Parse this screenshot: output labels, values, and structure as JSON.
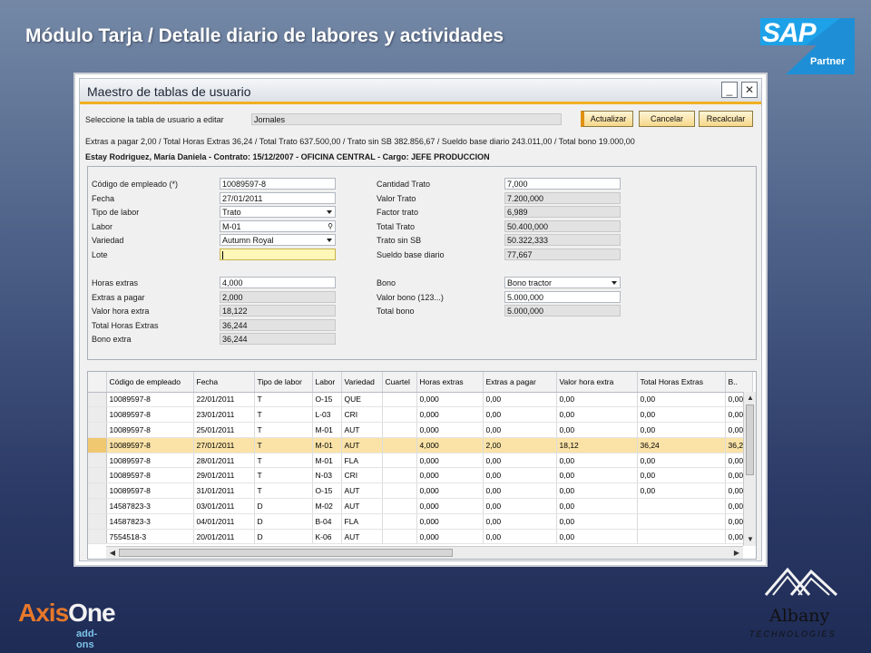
{
  "slide": {
    "title": "Módulo Tarja / Detalle diario de labores y actividades"
  },
  "brand": {
    "sap": "SAP",
    "partner": "Partner",
    "axis_main_1": "Axis",
    "axis_main_2": "One",
    "axis_sub": "add-ons",
    "albany": "Albany",
    "albany_sub": "TECHNOLOGIES"
  },
  "window": {
    "title": "Maestro de tablas de usuario",
    "minimize": "_",
    "close": "✕"
  },
  "top": {
    "select_label": "Seleccione la tabla de usuario a editar",
    "select_value": "Jornales",
    "btn_update": "Actualizar",
    "btn_cancel": "Cancelar",
    "btn_recalc": "Recalcular",
    "summary": "Extras a pagar 2,00 / Total Horas Extras 36,24 / Total Trato 637.500,00 / Trato sin SB 382.856,67 / Sueldo base diario 243.011,00 / Total bono 19.000,00",
    "employee": "Estay Rodriguez, María Daniela - Contrato: 15/12/2007 - OFICINA CENTRAL - Cargo: JEFE PRODUCCION"
  },
  "form": {
    "codigo_label": "Código de empleado (*)",
    "codigo": "10089597-8",
    "fecha_label": "Fecha",
    "fecha": "27/01/2011",
    "tipo_label": "Tipo de labor",
    "tipo": "Trato",
    "labor_label": "Labor",
    "labor": "M-01",
    "variedad_label": "Variedad",
    "variedad": "Autumn Royal",
    "lote_label": "Lote",
    "lote": "",
    "horas_label": "Horas extras",
    "horas": "4,000",
    "extras_label": "Extras a pagar",
    "extras": "2,000",
    "valor_hora_label": "Valor hora extra",
    "valor_hora": "18,122",
    "total_horas_label": "Total Horas Extras",
    "total_horas": "36,244",
    "bono_extra_label": "Bono extra",
    "bono_extra": "36,244",
    "cant_trato_label": "Cantidad Trato",
    "cant_trato": "7,000",
    "valor_trato_label": "Valor Trato",
    "valor_trato": "7.200,000",
    "factor_label": "Factor trato",
    "factor": "6,989",
    "total_trato_label": "Total Trato",
    "total_trato": "50.400,000",
    "trato_sb_label": "Trato sin SB",
    "trato_sb": "50.322,333",
    "sueldo_label": "Sueldo base diario",
    "sueldo": "77,667",
    "bono_label": "Bono",
    "bono": "Bono tractor",
    "valor_bono_label": "Valor bono (123...)",
    "valor_bono": "5.000,000",
    "total_bono_label": "Total bono",
    "total_bono": "5.000,000"
  },
  "grid": {
    "headers": [
      "Código de empleado",
      "Fecha",
      "Tipo de labor",
      "Labor",
      "Variedad",
      "Cuartel",
      "Horas extras",
      "Extras a pagar",
      "Valor hora extra",
      "Total Horas Extras",
      "B.."
    ],
    "rows": [
      [
        "10089597-8",
        "22/01/2011",
        "T",
        "O-15",
        "QUE",
        "",
        "0,000",
        "0,00",
        "0,00",
        "0,00",
        "0,00"
      ],
      [
        "10089597-8",
        "23/01/2011",
        "T",
        "L-03",
        "CRI",
        "",
        "0,000",
        "0,00",
        "0,00",
        "0,00",
        "0,00"
      ],
      [
        "10089597-8",
        "25/01/2011",
        "T",
        "M-01",
        "AUT",
        "",
        "0,000",
        "0,00",
        "0,00",
        "0,00",
        "0,00"
      ],
      [
        "10089597-8",
        "27/01/2011",
        "T",
        "M-01",
        "AUT",
        "",
        "4,000",
        "2,00",
        "18,12",
        "36,24",
        "36,2"
      ],
      [
        "10089597-8",
        "28/01/2011",
        "T",
        "M-01",
        "FLA",
        "",
        "0,000",
        "0,00",
        "0,00",
        "0,00",
        "0,00"
      ],
      [
        "10089597-8",
        "29/01/2011",
        "T",
        "N-03",
        "CRI",
        "",
        "0,000",
        "0,00",
        "0,00",
        "0,00",
        "0,00"
      ],
      [
        "10089597-8",
        "31/01/2011",
        "T",
        "O-15",
        "AUT",
        "",
        "0,000",
        "0,00",
        "0,00",
        "0,00",
        "0,00"
      ],
      [
        "14587823-3",
        "03/01/2011",
        "D",
        "M-02",
        "AUT",
        "",
        "0,000",
        "0,00",
        "0,00",
        "",
        "0,00"
      ],
      [
        "14587823-3",
        "04/01/2011",
        "D",
        "B-04",
        "FLA",
        "",
        "0,000",
        "0,00",
        "0,00",
        "",
        "0,00"
      ],
      [
        "7554518-3",
        "20/01/2011",
        "D",
        "K-06",
        "AUT",
        "",
        "0,000",
        "0,00",
        "0,00",
        "",
        "0,00"
      ]
    ],
    "selected_row": 3
  }
}
